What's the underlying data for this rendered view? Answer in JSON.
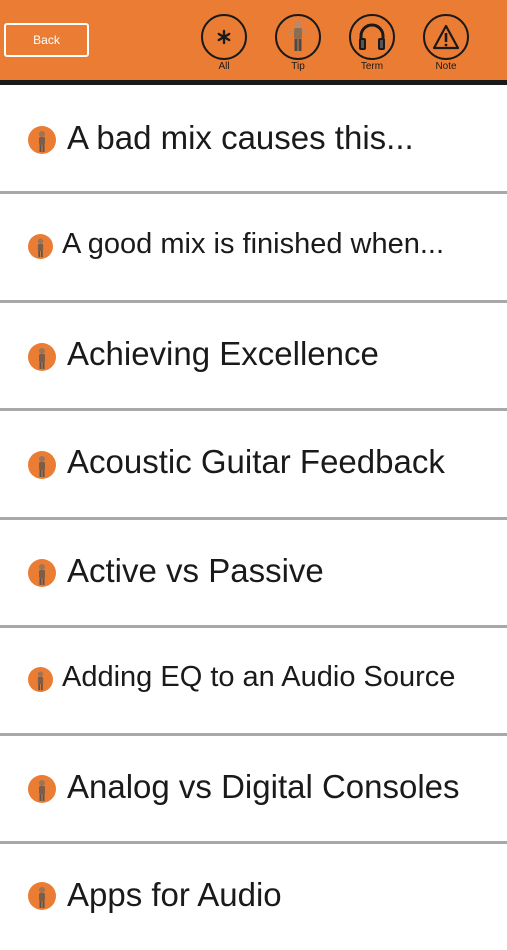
{
  "header": {
    "back_label": "Back",
    "filters": [
      {
        "label": "All",
        "icon": "asterisk-icon"
      },
      {
        "label": "Tip",
        "icon": "person-icon"
      },
      {
        "label": "Term",
        "icon": "headphones-icon"
      },
      {
        "label": "Note",
        "icon": "warning-triangle-icon"
      }
    ]
  },
  "list": {
    "items": [
      {
        "title": "A bad mix causes this..."
      },
      {
        "title": "A good mix is finished when..."
      },
      {
        "title": "Achieving Excellence"
      },
      {
        "title": "Acoustic Guitar Feedback"
      },
      {
        "title": "Active vs Passive"
      },
      {
        "title": "Adding EQ to an Audio Source"
      },
      {
        "title": "Analog vs Digital Consoles"
      },
      {
        "title": "Apps for Audio"
      }
    ]
  },
  "colors": {
    "accent": "#ea7d33",
    "divider": "#a8a8a8",
    "text": "#1a1a1a"
  }
}
